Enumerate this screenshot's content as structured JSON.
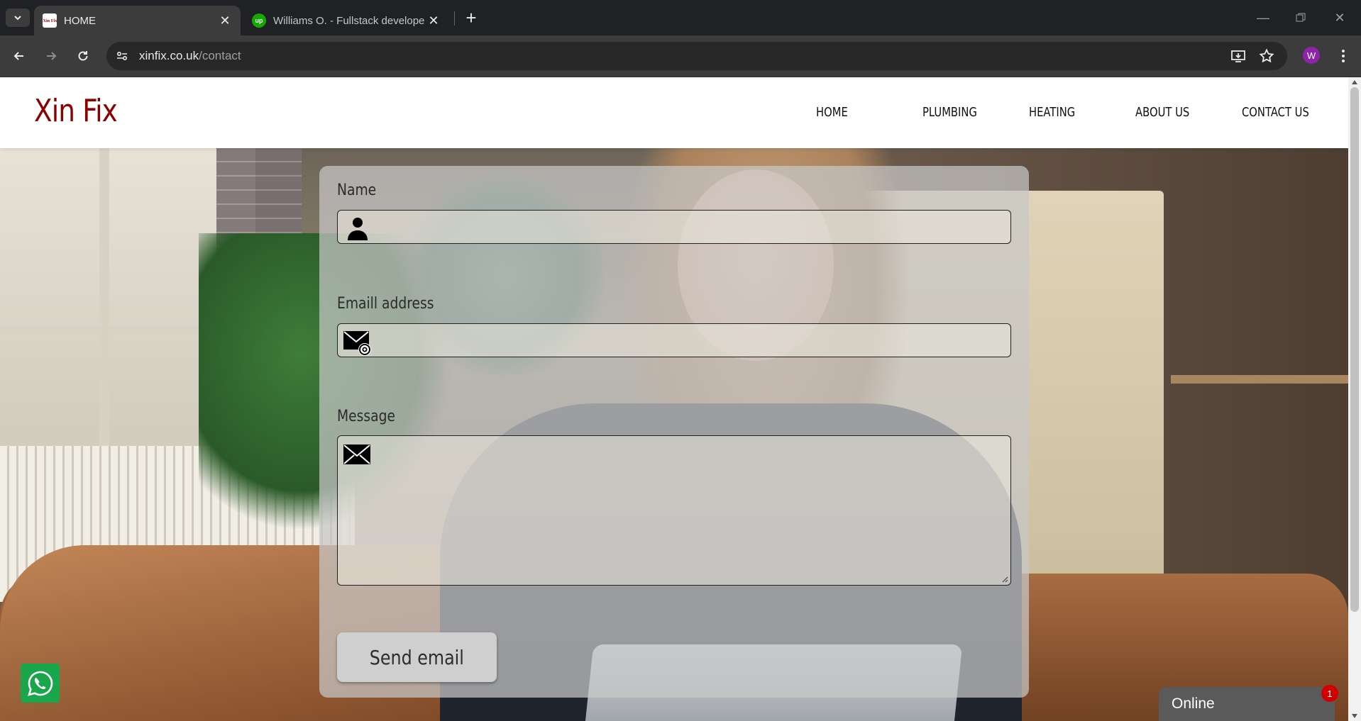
{
  "browser": {
    "tabs": [
      {
        "title": "HOME",
        "favicon_text": "Xin Fix",
        "active": true
      },
      {
        "title": "Williams O. - Fullstack develope",
        "favicon_text": "up",
        "active": false
      }
    ],
    "url_domain": "xinfix.co.uk",
    "url_path": "/contact",
    "profile_initial": "W",
    "icons": [
      "tab-list-icon",
      "close-icon",
      "new-tab-icon",
      "minimize-icon",
      "restore-icon",
      "back-arrow-icon",
      "forward-arrow-icon",
      "reload-icon",
      "site-settings-icon",
      "install-app-icon",
      "bookmark-star-icon",
      "kebab-menu-icon"
    ]
  },
  "site": {
    "logo": "Xin Fix",
    "logo_color": "#8b0000",
    "nav": [
      "HOME",
      "PLUMBING",
      "HEATING",
      "ABOUT US",
      "CONTACT US"
    ]
  },
  "form": {
    "name_label": "Name",
    "email_label": "Emaill address",
    "message_label": "Message",
    "name_value": "",
    "email_value": "",
    "message_value": "",
    "send_label": "Send email",
    "icons": [
      "person-icon",
      "email-at-icon",
      "envelope-icon"
    ]
  },
  "widgets": {
    "whatsapp_icon": "whatsapp-icon",
    "chat_label": "Online",
    "chat_badge": "1",
    "whatsapp_color": "#1aa64a"
  }
}
